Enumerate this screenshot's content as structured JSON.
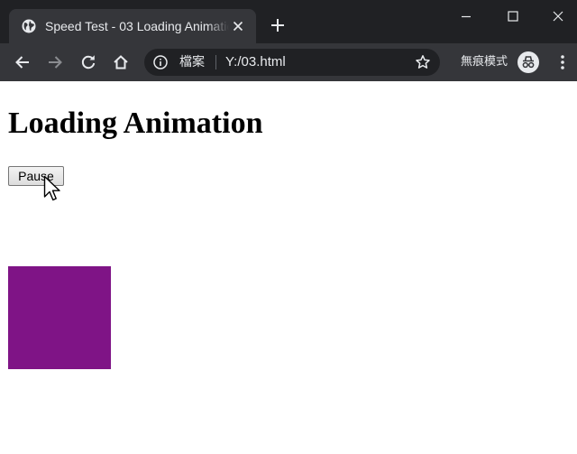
{
  "browser": {
    "tab": {
      "title": "Speed Test - 03 Loading Animation",
      "icon": "globe-icon"
    },
    "window_controls": [
      "minimize-icon",
      "maximize-icon",
      "close-icon"
    ],
    "toolbar": {
      "omnibox": {
        "scheme_label": "檔案",
        "url": "Y:/03.html"
      },
      "incognito_label": "無痕模式"
    },
    "colors": {
      "frame": "#202124",
      "toolbar": "#35363a",
      "text": "#e8eaed"
    }
  },
  "page": {
    "heading": "Loading Animation",
    "pause_button": "Pause",
    "animated_box_color": "#7f1486"
  }
}
